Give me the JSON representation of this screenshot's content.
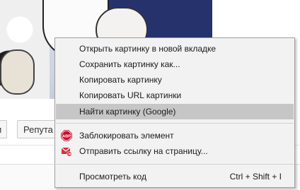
{
  "background": {
    "tags": [
      "и",
      "Репута"
    ]
  },
  "context_menu": {
    "items": [
      {
        "label": "Открыть картинку в новой вкладке"
      },
      {
        "label": "Сохранить картинку как..."
      },
      {
        "label": "Копировать картинку"
      },
      {
        "label": "Копировать URL картинки"
      },
      {
        "label": "Найти картинку (Google)"
      },
      {
        "label": "Заблокировать элемент",
        "icon": "adblock-plus-icon",
        "icon_text": "ABP"
      },
      {
        "label": "Отправить ссылку на страницу...",
        "icon": "mail-send-icon"
      },
      {
        "label": "Просмотреть код",
        "shortcut": "Ctrl + Shift + I"
      }
    ],
    "highlighted_index": 4,
    "colors": {
      "menu_bg": "#f2f2f2",
      "highlight_bg": "#c6c6c6",
      "abp_red": "#c70d2c",
      "mail_red": "#d9303e"
    }
  }
}
